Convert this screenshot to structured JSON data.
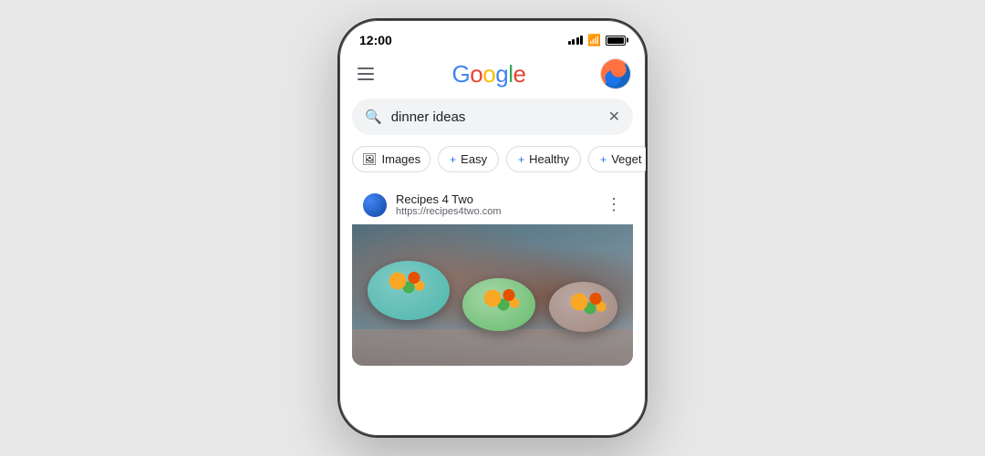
{
  "page": {
    "background_color": "#e8e8e8"
  },
  "status_bar": {
    "time": "12:00"
  },
  "header": {
    "hamburger_label": "Menu",
    "logo_text": "Google",
    "logo_letters": [
      "G",
      "o",
      "o",
      "g",
      "l",
      "e"
    ],
    "avatar_label": "User avatar"
  },
  "search": {
    "query": "dinner ideas",
    "placeholder": "Search",
    "clear_label": "Clear"
  },
  "chips": [
    {
      "label": "Images",
      "type": "images",
      "has_plus": false
    },
    {
      "label": "Easy",
      "type": "filter",
      "has_plus": true
    },
    {
      "label": "Healthy",
      "type": "filter",
      "has_plus": true
    },
    {
      "label": "Veget",
      "type": "filter",
      "has_plus": true
    }
  ],
  "result": {
    "site_name": "Recipes 4 Two",
    "site_url": "https://recipes4two.com",
    "more_label": "More options"
  }
}
